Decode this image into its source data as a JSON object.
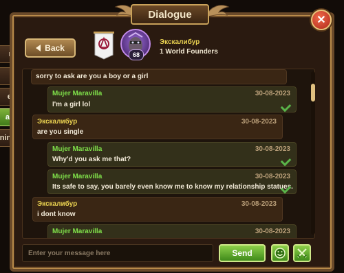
{
  "window": {
    "title": "Dialogue",
    "close_label": "✕"
  },
  "side_tabs": [
    {
      "label": "nt"
    },
    {
      "label": "t"
    },
    {
      "label": "es"
    },
    {
      "label": "ages"
    },
    {
      "label": "ning"
    }
  ],
  "toolbar": {
    "back_label": "Back"
  },
  "contact": {
    "name": "Экскалибур",
    "guild": "1 World Founders",
    "level": "68"
  },
  "messages": [
    {
      "text": "sorry to ask are you a boy or a girl"
    },
    {
      "sender": "Mujer Maravilla",
      "date": "30-08-2023",
      "text": "I'm a girl lol"
    },
    {
      "sender": "Экскалибур",
      "date": "30-08-2023",
      "text": "are you single"
    },
    {
      "sender": "Mujer Maravilla",
      "date": "30-08-2023",
      "text": "Why'd you ask me that?"
    },
    {
      "sender": "Mujer Maravilla",
      "date": "30-08-2023",
      "text": "Its safe to say, you barely even know me to know my relationship statues."
    },
    {
      "sender": "Экскалибур",
      "date": "30-08-2023",
      "text": "i dont know"
    },
    {
      "sender": "Mujer Maravilla",
      "date": "30-08-2023",
      "text": ""
    }
  ],
  "composer": {
    "placeholder": "Enter your message here",
    "send_label": "Send"
  },
  "colors": {
    "accent_green": "#7fe04a",
    "name_yellow": "#e8d050",
    "frame_gold": "#c9a25a"
  }
}
